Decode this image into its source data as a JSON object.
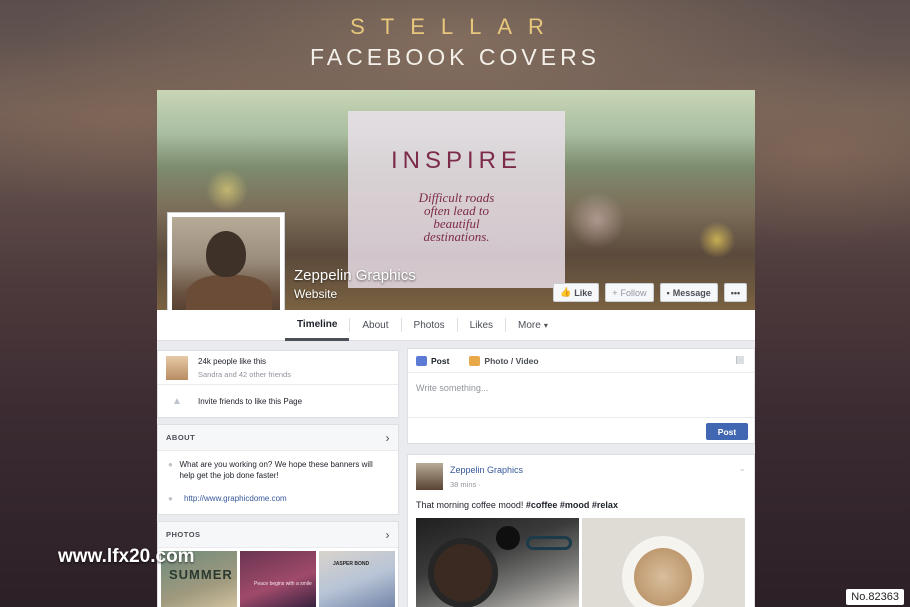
{
  "header": {
    "line1": "STELLAR",
    "line2": "FACEBOOK COVERS"
  },
  "cover": {
    "headline": "INSPIRE",
    "quote_lines": [
      "Difficult roads",
      "often lead to",
      "beautiful",
      "destinations."
    ]
  },
  "page": {
    "name": "Zeppelin Graphics",
    "category": "Website"
  },
  "actions": {
    "like": "Like",
    "follow": "Follow",
    "message": "Message",
    "more": "•••"
  },
  "nav": {
    "tabs": [
      {
        "label": "Timeline",
        "icon": ""
      },
      {
        "label": "About",
        "icon": ""
      },
      {
        "label": "Photos",
        "icon": ""
      },
      {
        "label": "Likes",
        "icon": ""
      },
      {
        "label": "More",
        "icon": "▾"
      }
    ]
  },
  "sidebar": {
    "likes_count": "24k people like this",
    "likes_friends": "Sandra and 42 other friends",
    "invite": "Invite friends to like this Page",
    "about_heading": "ABOUT",
    "about_text": "What are you working on? We hope these banners will help get the job done faster!",
    "about_link": "http://www.graphicdome.com",
    "photos_heading": "PHOTOS",
    "photo_thumbs": [
      {
        "title": "SUMMER",
        "subtitle": ""
      },
      {
        "title": "",
        "subtitle": "Peace begins with a smile"
      },
      {
        "title": "JASPER BOND",
        "subtitle": ""
      }
    ]
  },
  "composer": {
    "tab_post": "Post",
    "tab_photo": "Photo / Video",
    "placeholder": "Write something...",
    "submit": "Post"
  },
  "feed": {
    "author": "Zeppelin Graphics",
    "time": "38 mins",
    "text_plain": "That morning coffee mood! ",
    "hashtags": "#coffee #mood #relax"
  },
  "watermark": "www.lfx20.com",
  "badge": "No.82363"
}
